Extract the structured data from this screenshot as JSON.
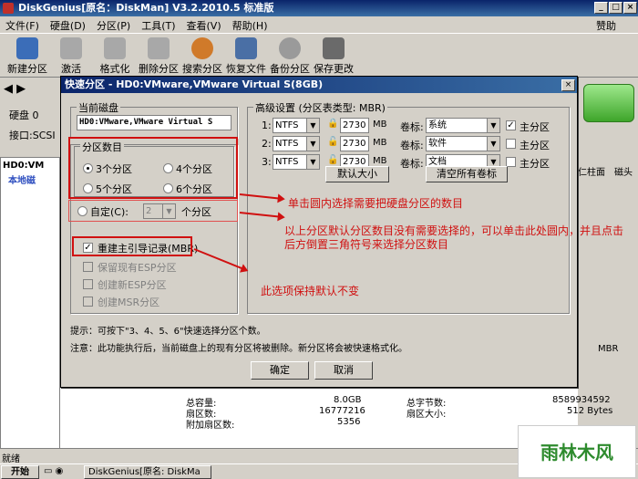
{
  "window": {
    "title": "DiskGenius[原名：DiskMan] V3.2.2010.5 标准版",
    "help": "赞助"
  },
  "menu": [
    "文件(F)",
    "硬盘(D)",
    "分区(P)",
    "工具(T)",
    "查看(V)",
    "帮助(H)"
  ],
  "toolbar": [
    {
      "label": "新建分区",
      "icon": "new-partition-icon",
      "color": "#3b6db8"
    },
    {
      "label": "激活",
      "icon": "activate-icon",
      "color": "#8a8a8a"
    },
    {
      "label": "格式化",
      "icon": "format-icon",
      "color": "#8a8a8a"
    },
    {
      "label": "删除分区",
      "icon": "delete-partition-icon",
      "color": "#8a8a8a"
    },
    {
      "label": "搜索分区",
      "icon": "search-partition-icon",
      "color": "#d07a2a"
    },
    {
      "label": "恢复文件",
      "icon": "restore-file-icon",
      "color": "#4a6fa5"
    },
    {
      "label": "备份分区",
      "icon": "backup-partition-icon",
      "color": "#7a7a7a"
    },
    {
      "label": "保存更改",
      "icon": "save-changes-icon",
      "color": "#5a5a5a"
    }
  ],
  "left": {
    "disk_label": "硬盘 0",
    "iface": "接口:SCSI",
    "tree_root": "HD0:VM",
    "tree_child": "本地磁"
  },
  "right_cols": [
    "仁柱面",
    "磁头"
  ],
  "dialog": {
    "title": "快速分区 - HD0:VMware,VMware Virtual S(8GB)",
    "current_disk_group": "当前磁盘",
    "current_disk_value": "HD0:VMware,VMware Virtual S",
    "count_group": "分区数目",
    "counts": [
      "3个分区",
      "4个分区",
      "5个分区",
      "6个分区"
    ],
    "custom_label": "自定(C):",
    "custom_value": "2",
    "custom_suffix": "个分区",
    "mbr_label": "重建主引导记录(MBR)",
    "opt_esp_keep": "保留现有ESP分区",
    "opt_esp_new": "创建新ESP分区",
    "opt_msr": "创建MSR分区",
    "adv_group": "高级设置 (分区表类型: MBR)",
    "rows": [
      {
        "n": "1:",
        "fs": "NTFS",
        "size": "2730",
        "unit": "MB",
        "vol_label": "卷标:",
        "vol": "系统",
        "primary": "主分区",
        "checked": true
      },
      {
        "n": "2:",
        "fs": "NTFS",
        "size": "2730",
        "unit": "MB",
        "vol_label": "卷标:",
        "vol": "软件",
        "primary": "主分区",
        "checked": false
      },
      {
        "n": "3:",
        "fs": "NTFS",
        "size": "2730",
        "unit": "MB",
        "vol_label": "卷标:",
        "vol": "文档",
        "primary": "主分区",
        "checked": false
      }
    ],
    "default_size_btn": "默认大小",
    "clear_labels_btn": "清空所有卷标",
    "hint": "提示：可按下\"3、4、5、6\"快速选择分区个数。",
    "note": "注意：此功能执行后，当前磁盘上的现有分区将被删除。新分区将会被快速格式化。",
    "ok": "确定",
    "cancel": "取消"
  },
  "annotations": {
    "a1": "单击圆内选择需要把硬盘分区的数目",
    "a2_line1": "以上分区默认分区数目没有需要选择的，可以单击此处圆内，并且点击",
    "a2_line2": "后方倒置三角符号来选择分区数目",
    "a3": "此选项保持默认不变"
  },
  "info": {
    "mbr": "MBR",
    "total_cap_label": "总容量:",
    "total_cap": "8.0GB",
    "total_bytes_label": "总字节数:",
    "total_bytes": "8589934592",
    "sectors_label": "扇区数:",
    "sectors": "16777216",
    "sector_size_label": "扇区大小:",
    "sector_size": "512 Bytes",
    "extra_label": "附加扇区数:",
    "extra": "5356"
  },
  "status": "就绪",
  "taskbar": {
    "start": "开始",
    "task": "DiskGenius[原名: DiskMa"
  },
  "watermark": "雨林木风"
}
